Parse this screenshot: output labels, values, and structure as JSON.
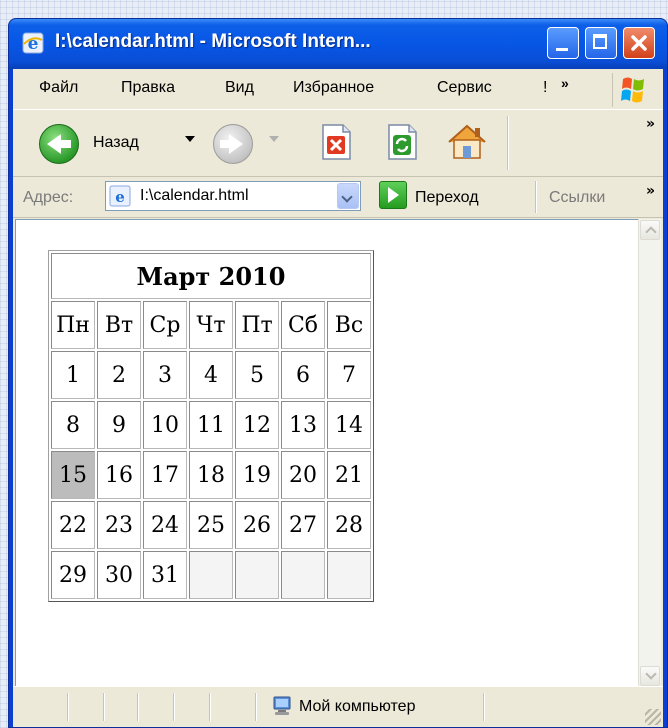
{
  "window": {
    "title": "I:\\calendar.html - Microsoft Intern..."
  },
  "menu": {
    "items": [
      {
        "label": "Файл"
      },
      {
        "label": "Правка"
      },
      {
        "label": "Вид"
      },
      {
        "label": "Избранное"
      },
      {
        "label": "Сервис"
      },
      {
        "label": "!"
      }
    ],
    "overflow": "»"
  },
  "toolbar": {
    "back_label": "Назад",
    "overflow": "»"
  },
  "address": {
    "label": "Адрес:",
    "value": "I:\\calendar.html",
    "go_label": "Переход",
    "links_label": "Ссылки",
    "overflow": "»"
  },
  "calendar": {
    "title": "Март 2010",
    "weekdays": [
      "Пн",
      "Вт",
      "Ср",
      "Чт",
      "Пт",
      "Сб",
      "Вс"
    ],
    "weeks": [
      [
        "1",
        "2",
        "3",
        "4",
        "5",
        "6",
        "7"
      ],
      [
        "8",
        "9",
        "10",
        "11",
        "12",
        "13",
        "14"
      ],
      [
        "15",
        "16",
        "17",
        "18",
        "19",
        "20",
        "21"
      ],
      [
        "22",
        "23",
        "24",
        "25",
        "26",
        "27",
        "28"
      ],
      [
        "29",
        "30",
        "31",
        "",
        "",
        "",
        ""
      ]
    ],
    "highlighted_day": "15"
  },
  "status": {
    "zone": "Мой компьютер"
  },
  "colors": {
    "titlebar": "#0756e6",
    "highlight_cell": "#bcbcbc",
    "chrome": "#ece9d8"
  }
}
